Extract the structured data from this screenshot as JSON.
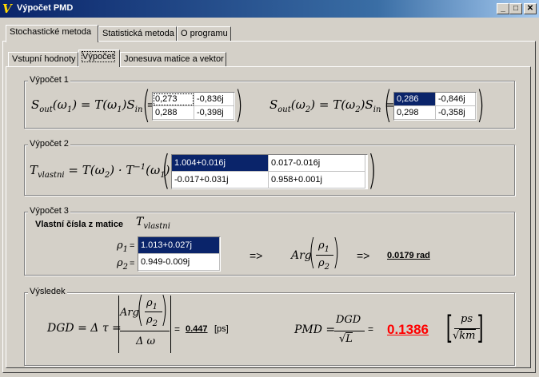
{
  "window": {
    "title": "Výpočet PMD",
    "icon": "app-logo-icon",
    "buttons": {
      "minimize": "_",
      "maximize": "□",
      "close": "✕"
    }
  },
  "tabs": [
    "Stochastické metoda",
    "Statistická metoda",
    "O programu"
  ],
  "subtabs": [
    "Vstupní hodnoty",
    "Výpočet",
    "Jonesuva matice a vektor"
  ],
  "vypocet1": {
    "label": "Výpočet 1",
    "matrix1": [
      [
        "0,273",
        "-0,836j"
      ],
      [
        "0,288",
        "-0,398j"
      ]
    ],
    "matrix2": [
      [
        "0,286",
        "-0,846j"
      ],
      [
        "0,298",
        "-0,358j"
      ]
    ]
  },
  "vypocet2": {
    "label": "Výpočet 2",
    "matrix": [
      [
        "1.004+0.016j",
        "0.017-0.016j"
      ],
      [
        "-0.017+0.031j",
        "0.958+0.001j"
      ]
    ]
  },
  "vypocet3": {
    "label": "Výpočet 3",
    "heading": "Vlastní čísla z matice",
    "rho1_label": "=",
    "rho2_label": "=",
    "rho1": "1.013+0.027j",
    "rho2": "0.949-0.009j",
    "arrow1": "=>",
    "arrow2": "=>",
    "result": "0.0179 rad"
  },
  "vysledek": {
    "label": "Výsledek",
    "dgd_value": "0.447",
    "dgd_unit": "[ps]",
    "pmd_value": "0.1386"
  },
  "colors": {
    "selected": "#0a246a",
    "pmd_result": "#ff0000",
    "titlebar": "#0a246a"
  }
}
